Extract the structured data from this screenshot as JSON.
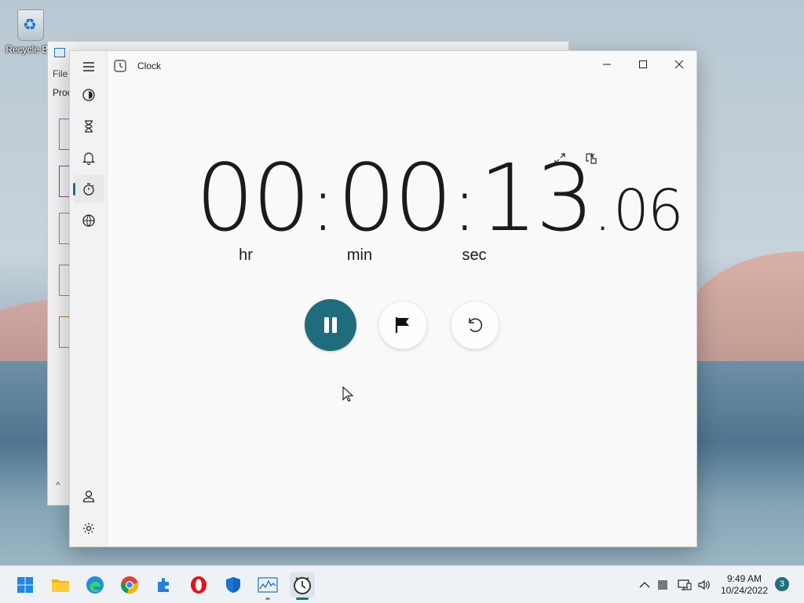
{
  "desktop": {
    "recycle_bin_label": "Recycle Bin"
  },
  "background_window": {
    "menu_file": "File",
    "tab_processes": "Proc"
  },
  "clock_app": {
    "title": "Clock",
    "nav": {
      "items": [
        {
          "name": "focus-sessions",
          "icon": "focus-icon"
        },
        {
          "name": "timer",
          "icon": "hourglass-icon"
        },
        {
          "name": "alarm",
          "icon": "bell-icon"
        },
        {
          "name": "stopwatch",
          "icon": "stopwatch-icon",
          "active": true
        },
        {
          "name": "world-clock",
          "icon": "globe-icon"
        }
      ],
      "bottom_items": [
        {
          "name": "account",
          "icon": "person-icon"
        },
        {
          "name": "settings",
          "icon": "gear-icon"
        }
      ]
    },
    "stopwatch": {
      "hours": "00",
      "minutes": "00",
      "seconds": "13",
      "fraction": "06",
      "separator": ":",
      "decimal": ".",
      "unit_hr": "hr",
      "unit_min": "min",
      "unit_sec": "sec",
      "state": "running"
    },
    "accent_color": "#1f6d7c"
  },
  "taskbar": {
    "apps": [
      {
        "name": "start",
        "icon": "windows-logo-icon"
      },
      {
        "name": "file-explorer",
        "icon": "folder-icon"
      },
      {
        "name": "edge",
        "icon": "edge-icon"
      },
      {
        "name": "chrome",
        "icon": "chrome-icon"
      },
      {
        "name": "app-blue",
        "icon": "puzzle-icon"
      },
      {
        "name": "opera",
        "icon": "opera-icon"
      },
      {
        "name": "security",
        "icon": "shield-icon"
      },
      {
        "name": "task-manager",
        "icon": "performance-icon",
        "running": true
      },
      {
        "name": "clock",
        "icon": "clock-icon",
        "active": true
      }
    ],
    "time": "9:49 AM",
    "date": "10/24/2022",
    "notification_count": "3"
  }
}
